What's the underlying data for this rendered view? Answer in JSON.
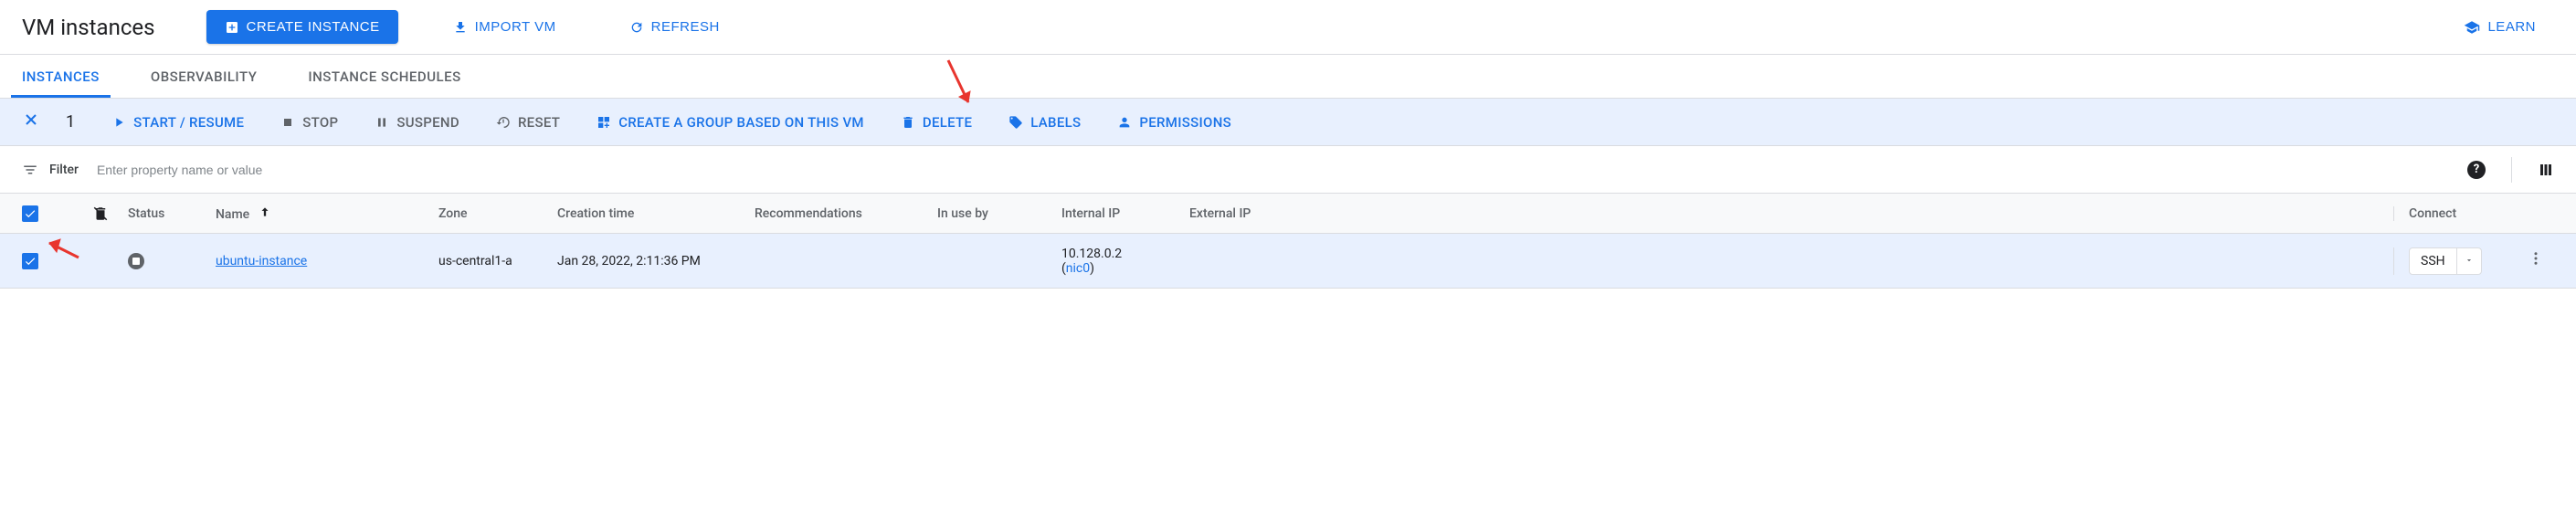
{
  "header": {
    "title": "VM instances",
    "create_label": "CREATE INSTANCE",
    "import_label": "IMPORT VM",
    "refresh_label": "REFRESH",
    "learn_label": "LEARN"
  },
  "tabs": [
    {
      "label": "INSTANCES",
      "active": true
    },
    {
      "label": "OBSERVABILITY",
      "active": false
    },
    {
      "label": "INSTANCE SCHEDULES",
      "active": false
    }
  ],
  "selection": {
    "count": "1",
    "actions": {
      "start": "START / RESUME",
      "stop": "STOP",
      "suspend": "SUSPEND",
      "reset": "RESET",
      "group": "CREATE A GROUP BASED ON THIS VM",
      "delete": "DELETE",
      "labels": "LABELS",
      "permissions": "PERMISSIONS"
    }
  },
  "filter": {
    "label": "Filter",
    "placeholder": "Enter property name or value"
  },
  "table": {
    "headers": {
      "status": "Status",
      "name": "Name",
      "zone": "Zone",
      "ctime": "Creation time",
      "rec": "Recommendations",
      "inuse": "In use by",
      "iip": "Internal IP",
      "eip": "External IP",
      "connect": "Connect"
    },
    "rows": [
      {
        "name": "ubuntu-instance",
        "zone": "us-central1-a",
        "ctime": "Jan 28, 2022, 2:11:36 PM",
        "rec": "",
        "inuse": "",
        "iip": "10.128.0.2",
        "nic": "nic0",
        "eip": "",
        "ssh": "SSH"
      }
    ]
  }
}
